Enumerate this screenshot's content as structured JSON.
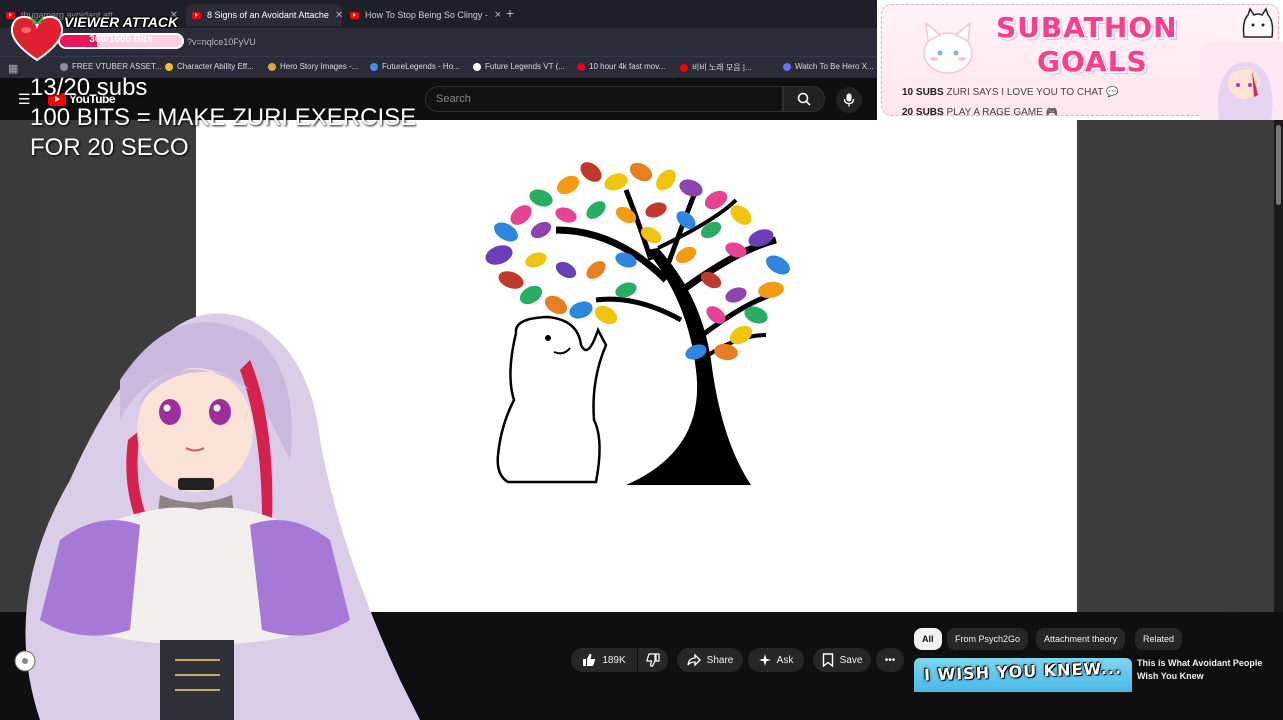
{
  "browser": {
    "tabs": [
      {
        "label": "thugamerg avoidant att..."
      },
      {
        "label": "8 Signs of an Avoidant Attache"
      },
      {
        "label": "How To Stop Being So Clingy -"
      }
    ],
    "url": "?v=nqlce10FyVU",
    "bookmarks": [
      {
        "label": "FREE VTUBER ASSET...",
        "color": "#8e8ea0"
      },
      {
        "label": "Character Ability Eff...",
        "color": "#f2c12e"
      },
      {
        "label": "Hero Story Images -...",
        "color": "#d9a441"
      },
      {
        "label": "FutureLegends - Ho...",
        "color": "#4a8ae8"
      },
      {
        "label": "Future Legends VT (...",
        "color": "#ffffff"
      },
      {
        "label": "10 hour 4k fast mov...",
        "color": "#e60023"
      },
      {
        "label": "비비 노래 모음 |...",
        "color": "#ff0000"
      },
      {
        "label": "Watch To Be Hero X...",
        "color": "#6c6cff"
      }
    ]
  },
  "youtube": {
    "logo_text": "YouTube",
    "search_placeholder": "Search",
    "actions": {
      "like_count": "189K",
      "share": "Share",
      "ask": "Ask",
      "save": "Save"
    },
    "chips": [
      "All",
      "From Psych2Go",
      "Attachment theory",
      "Related"
    ],
    "recommended": {
      "thumb_text": "I WISH YOU KNEW...",
      "title": "This is What Avoidant People Wish You Knew"
    }
  },
  "overlay": {
    "subs": "13/20 subs",
    "bits_line_1": "100 BITS = MAKE ZURI EXERCISE",
    "bits_line_2": "FOR 20 SECO"
  },
  "viewer_attack": {
    "title": "VIEWER ATTACK",
    "bits_text": "300/1000 Bits",
    "progress": 0.3
  },
  "subathon": {
    "title_1": "SUBATHON",
    "title_2": "GOALS",
    "goals": [
      {
        "count": "10 SUBS",
        "text": "ZURI SAYS I LOVE YOU TO CHAT"
      },
      {
        "count": "20 SUBS",
        "text": "PLAY A RAGE GAME"
      }
    ]
  }
}
